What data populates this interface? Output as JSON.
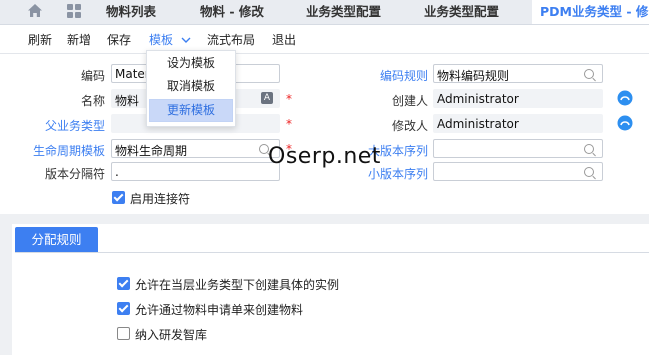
{
  "tabs": {
    "items": [
      "物料列表",
      "物料 - 修改",
      "业务类型配置",
      "业务类型配置",
      "PDM业务类型 - 修"
    ]
  },
  "toolbar": {
    "refresh": "刷新",
    "add": "新增",
    "save": "保存",
    "template": "模板",
    "flow_layout": "流式布局",
    "exit": "退出"
  },
  "template_menu": {
    "items": [
      "设为模板",
      "取消模板",
      "更新模板"
    ],
    "highlighted": "更新模板"
  },
  "form": {
    "code": {
      "label": "编码",
      "value": "Mater"
    },
    "name": {
      "label": "名称",
      "value": "物料",
      "lang_badge": "A"
    },
    "parent_type": {
      "label": "父业务类型",
      "value": ""
    },
    "lifecycle": {
      "label": "生命周期模板",
      "value": "物料生命周期"
    },
    "version_sep": {
      "label": "版本分隔符",
      "value": "."
    },
    "enable_connector": {
      "label": "启用连接符",
      "checked": true
    },
    "code_rule": {
      "label": "编码规则",
      "value": "物料编码规则"
    },
    "creator": {
      "label": "创建人",
      "value": "Administrator"
    },
    "modifier": {
      "label": "修改人",
      "value": "Administrator"
    },
    "major_seq": {
      "label": "大版本序列",
      "value": ""
    },
    "minor_seq": {
      "label": "小版本序列",
      "value": ""
    },
    "required_mark": "*"
  },
  "watermark": "Oserp.net",
  "section": {
    "tab_label": "分配规则",
    "options": [
      {
        "label": "允许在当层业务类型下创建具体的实例",
        "checked": true
      },
      {
        "label": "允许通过物料申请单来创建物料",
        "checked": true
      },
      {
        "label": "纳入研发智库",
        "checked": false
      }
    ]
  },
  "colors": {
    "accent": "#3d7ff1",
    "required": "#e22222",
    "tabbar": "#e9ecf1"
  }
}
